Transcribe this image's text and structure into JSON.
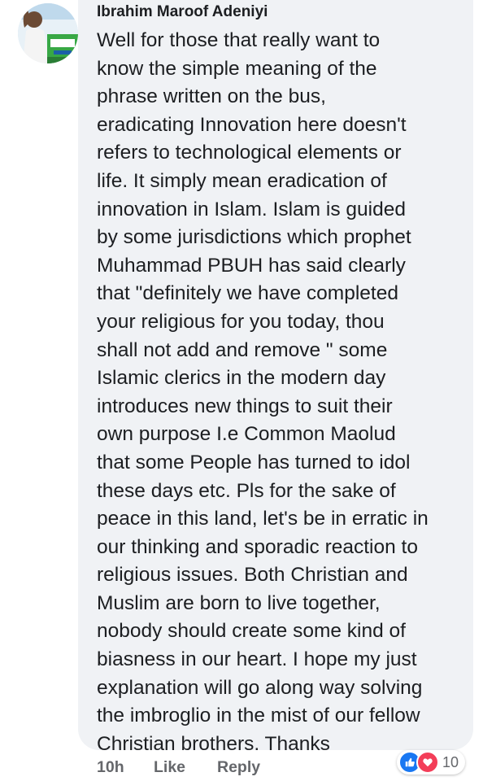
{
  "comment": {
    "author": "Ibrahim Maroof Adeniyi",
    "text": "Well for those that really want to\nknow the simple meaning of the\nphrase written on the bus,\neradicating Innovation here doesn't\nrefers to technological elements or\nlife. It simply mean eradication of\ninnovation in Islam. Islam is guided\nby some jurisdictions which prophet\nMuhammad PBUH has said clearly\nthat \"definitely we have completed\nyour religious for you today, thou\nshall not add and remove \" some\nIslamic clerics in the modern day\nintroduces new things to suit their\nown purpose I.e Common Maolud\nthat some People has turned to idol\nthese days etc. Pls for the sake of\npeace in this land, let's be in erratic in\nour thinking and sporadic reaction to\nreligious issues. Both Christian and\nMuslim are born to live together,\nnobody should create some kind of\nbiasness in our heart. I hope my just\nexplanation will go along way solving\nthe imbroglio in the mist of our fellow\nChristian brothers. Thanks",
    "timestamp": "10h",
    "like_label": "Like",
    "reply_label": "Reply",
    "reaction_count": "10"
  },
  "icons": {
    "like_reaction": "thumbs-up-icon",
    "love_reaction": "heart-icon"
  },
  "colors": {
    "bubble_bg": "#f0f2f5",
    "text": "#1c1e21",
    "secondary_text": "#65676b",
    "like_blue": "#1877f2",
    "love_red": "#f33e58"
  }
}
